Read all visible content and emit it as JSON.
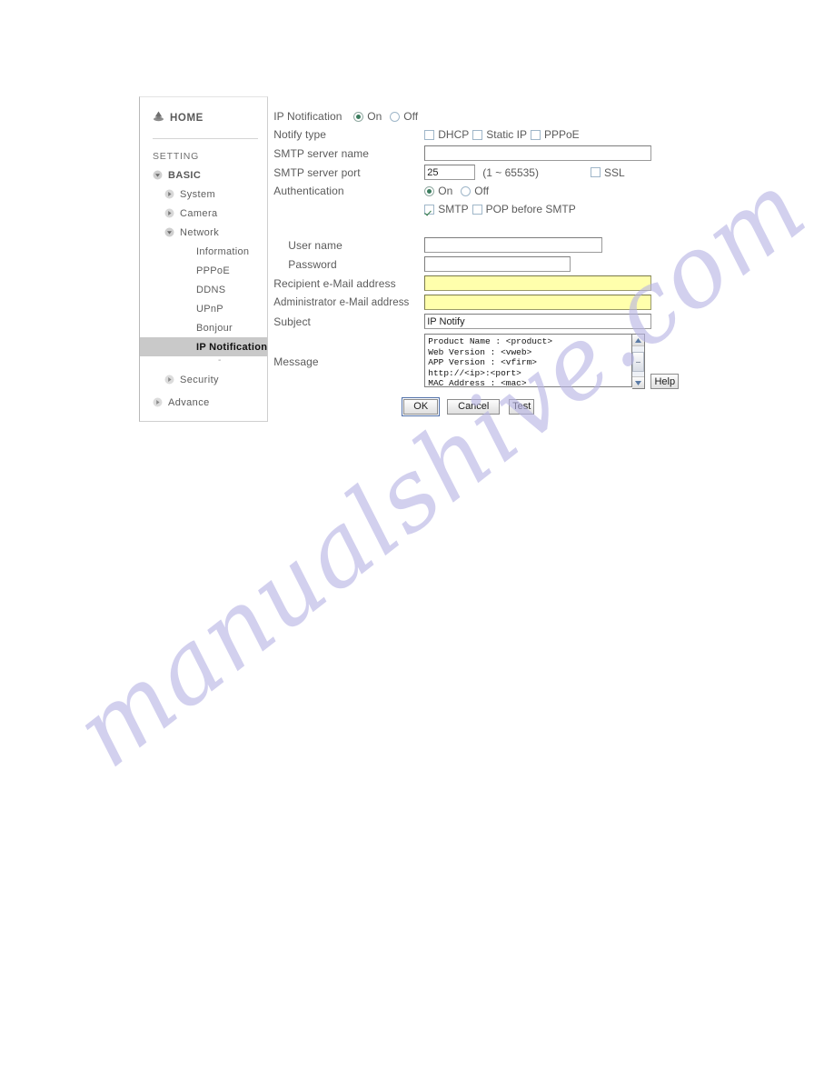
{
  "sidebar": {
    "home": {
      "label": "HOME",
      "icon": "home-icon"
    },
    "setting_label": "SETTING",
    "items": [
      {
        "label": "BASIC",
        "level": 0,
        "icon": "triangle-down-icon",
        "selected": false
      },
      {
        "label": "System",
        "level": 1,
        "icon": "triangle-right-icon",
        "selected": false
      },
      {
        "label": "Camera",
        "level": 1,
        "icon": "triangle-right-icon",
        "selected": false
      },
      {
        "label": "Network",
        "level": 1,
        "icon": "triangle-down-icon",
        "selected": false
      },
      {
        "label": "Information",
        "level": 2,
        "icon": "none",
        "selected": false
      },
      {
        "label": "PPPoE",
        "level": 2,
        "icon": "none",
        "selected": false
      },
      {
        "label": "DDNS",
        "level": 2,
        "icon": "none",
        "selected": false
      },
      {
        "label": "UPnP",
        "level": 2,
        "icon": "none",
        "selected": false
      },
      {
        "label": "Bonjour",
        "level": 2,
        "icon": "none",
        "selected": false
      },
      {
        "label": "IP Notification",
        "level": 2,
        "icon": "none",
        "selected": true
      },
      {
        "label": "Security",
        "level": 1,
        "icon": "triangle-right-icon",
        "selected": false
      },
      {
        "label": "Advance",
        "level": 0,
        "icon": "triangle-right-icon",
        "selected": false
      }
    ],
    "separator_dash": "-"
  },
  "form": {
    "ip_notification": {
      "label": "IP Notification",
      "on_label": "On",
      "off_label": "Off",
      "value": "On"
    },
    "notify_type": {
      "label": "Notify type",
      "options": [
        {
          "label": "DHCP",
          "checked": false
        },
        {
          "label": "Static IP",
          "checked": false
        },
        {
          "label": "PPPoE",
          "checked": false
        }
      ]
    },
    "smtp_server_name": {
      "label": "SMTP server name",
      "value": "",
      "placeholder": ""
    },
    "smtp_server_port": {
      "label": "SMTP server port",
      "value": "25",
      "hint": "(1 ~ 65535)"
    },
    "ssl": {
      "label": "SSL",
      "checked": false
    },
    "authentication": {
      "label": "Authentication",
      "on_label": "On",
      "off_label": "Off",
      "value": "On",
      "methods": [
        {
          "label": "SMTP",
          "checked": true
        },
        {
          "label": "POP before SMTP",
          "checked": false
        }
      ]
    },
    "user_name": {
      "label": "User name",
      "value": ""
    },
    "password": {
      "label": "Password",
      "value": ""
    },
    "recipient_email": {
      "label": "Recipient e-Mail address",
      "value": ""
    },
    "administrator_email": {
      "label": "Administrator e-Mail address",
      "value": ""
    },
    "subject": {
      "label": "Subject",
      "value": "IP Notify"
    },
    "message": {
      "label": "Message",
      "value": "Product Name : <product>\nWeb Version : <vweb>\nAPP Version : <vfirm>\nhttp://<ip>:<port>\nMAC Address : <mac>"
    },
    "buttons": {
      "ok": "OK",
      "cancel": "Cancel",
      "test": "Test",
      "help": "Help"
    },
    "scrollbar": {
      "up_icon": "chevron-up-icon",
      "down_icon": "chevron-down-icon"
    }
  },
  "watermark": {
    "text": "manualshive.com"
  },
  "colors": {
    "yellow_field": "#ffffac",
    "radio_accent": "#3b7d5e",
    "check_accent": "#2f7a44",
    "selected_nav_bg": "#c9c9c9"
  }
}
